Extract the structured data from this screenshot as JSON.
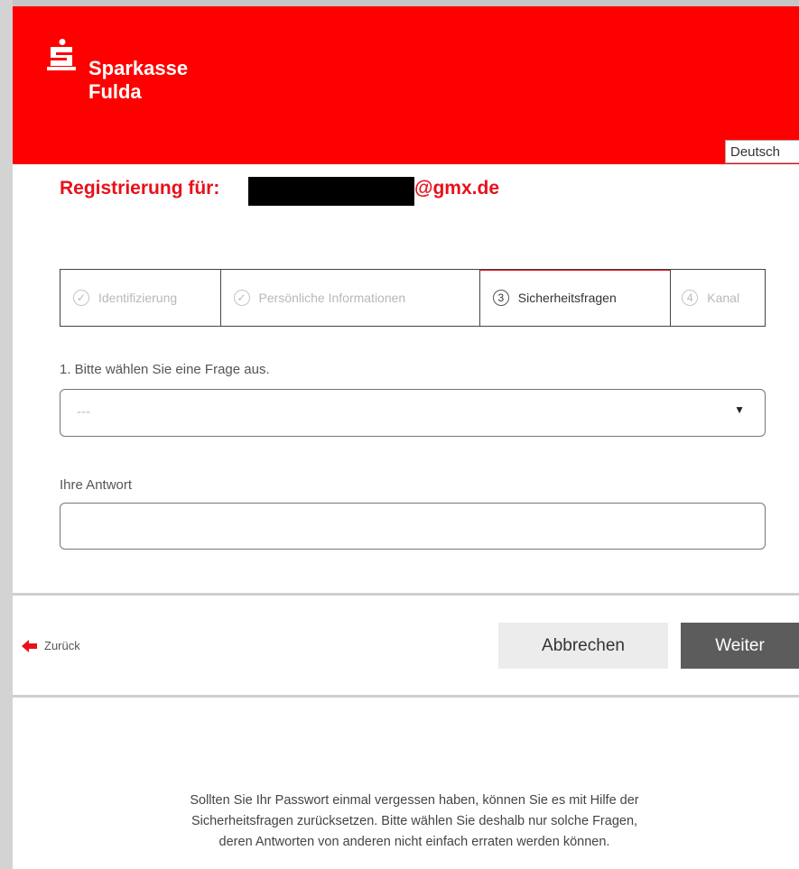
{
  "header": {
    "brand_line1": "Sparkasse",
    "brand_line2": "Fulda",
    "language": "Deutsch",
    "accent_color": "#ff0000"
  },
  "registration": {
    "title_prefix": "Registrierung für:",
    "email_suffix": "@gmx.de"
  },
  "steps": [
    {
      "marker": "✓",
      "label": "Identifizierung",
      "state": "done"
    },
    {
      "marker": "✓",
      "label": "Persönliche Informationen",
      "state": "done"
    },
    {
      "marker": "3",
      "label": "Sicherheitsfragen",
      "state": "active"
    },
    {
      "marker": "4",
      "label": "Kanal",
      "state": "pending"
    }
  ],
  "question": {
    "label": "1. Bitte wählen Sie eine Frage aus.",
    "selected": "---"
  },
  "answer": {
    "label": "Ihre Antwort",
    "value": ""
  },
  "actions": {
    "back": "Zurück",
    "cancel": "Abbrechen",
    "next": "Weiter"
  },
  "footer": {
    "line1": "Sollten Sie Ihr Passwort einmal vergessen haben, können Sie es mit Hilfe der",
    "line2": "Sicherheitsfragen zurücksetzen. Bitte wählen Sie deshalb nur solche Fragen,",
    "line3": "deren Antworten von anderen nicht einfach erraten werden können."
  },
  "icons": {
    "logo": "sparkasse-logo-icon",
    "step_done": "check-circle-icon",
    "dropdown": "caret-down-icon",
    "back": "arrow-left-icon"
  }
}
